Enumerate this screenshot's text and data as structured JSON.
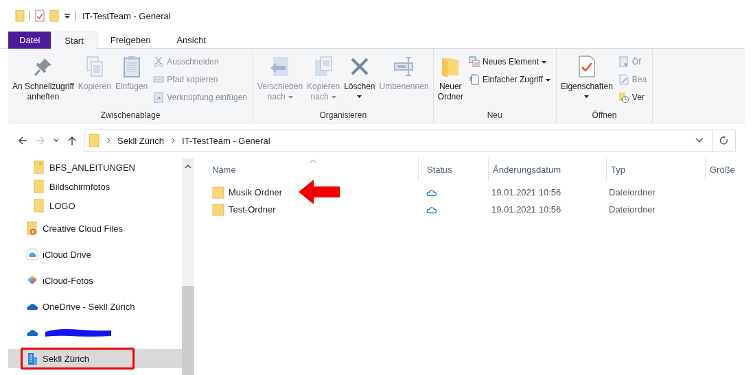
{
  "title_bar": {
    "title": "IT-TestTeam - General"
  },
  "ribbon_tabs": [
    {
      "label": "Datei",
      "kind": "file",
      "selected": false
    },
    {
      "label": "Start",
      "kind": "tab",
      "selected": true
    },
    {
      "label": "Freigeben",
      "kind": "tab",
      "selected": false
    },
    {
      "label": "Ansicht",
      "kind": "tab",
      "selected": false
    }
  ],
  "ribbon_groups": [
    {
      "label": "Zwischenablage",
      "items": [
        {
          "kind": "large",
          "lines": [
            "An Schnellzugriff",
            "anheften"
          ],
          "disabled": false,
          "dropdown": false
        },
        {
          "kind": "large",
          "lines": [
            "Kopieren"
          ],
          "disabled": true,
          "dropdown": false
        },
        {
          "kind": "large",
          "lines": [
            "Einfügen"
          ],
          "disabled": true,
          "dropdown": false
        },
        {
          "kind": "small",
          "lines": [
            "Ausschneiden"
          ],
          "disabled": true,
          "dropdown": false
        },
        {
          "kind": "small",
          "lines": [
            "Pfad kopieren"
          ],
          "disabled": true,
          "dropdown": false
        },
        {
          "kind": "small",
          "lines": [
            "Verknüpfung einfügen"
          ],
          "disabled": true,
          "dropdown": false
        }
      ]
    },
    {
      "label": "Organisieren",
      "items": [
        {
          "kind": "large",
          "lines": [
            "Verschieben",
            "nach"
          ],
          "disabled": true,
          "dropdown": true
        },
        {
          "kind": "large",
          "lines": [
            "Kopieren",
            "nach"
          ],
          "disabled": true,
          "dropdown": true
        },
        {
          "kind": "large",
          "lines": [
            "Löschen"
          ],
          "disabled": false,
          "dropdown": true
        },
        {
          "kind": "large",
          "lines": [
            "Umbenennen"
          ],
          "disabled": true,
          "dropdown": false
        }
      ]
    },
    {
      "label": "Neu",
      "items": [
        {
          "kind": "large",
          "lines": [
            "Neuer",
            "Ordner"
          ],
          "disabled": false,
          "dropdown": false
        },
        {
          "kind": "small",
          "lines": [
            "Neues Element"
          ],
          "disabled": false,
          "dropdown": true
        },
        {
          "kind": "small",
          "lines": [
            "Einfacher Zugriff"
          ],
          "disabled": false,
          "dropdown": true
        }
      ]
    },
    {
      "label": "Öffnen",
      "items": [
        {
          "kind": "large",
          "lines": [
            "Eigenschaften"
          ],
          "disabled": false,
          "dropdown": true
        },
        {
          "kind": "small",
          "lines": [
            "Öf"
          ],
          "disabled": true,
          "dropdown": false
        },
        {
          "kind": "small",
          "lines": [
            "Bea"
          ],
          "disabled": true,
          "dropdown": false
        },
        {
          "kind": "small",
          "lines": [
            "Ver"
          ],
          "disabled": false,
          "dropdown": false
        }
      ]
    }
  ],
  "navigation": {
    "back_disabled": false,
    "forward_disabled": true,
    "up_disabled": false
  },
  "address_bar": {
    "crumbs": [
      "Sekll Zürich",
      "IT-TestTeam - General"
    ]
  },
  "sidebar": {
    "items": [
      {
        "children": [
          {
            "label": "BFS_ANLEITUNGEN",
            "kind": "folder-doc",
            "selected": false,
            "highlighted": false
          },
          {
            "label": "Bildschirmfotos",
            "kind": "folder",
            "selected": false,
            "highlighted": false
          },
          {
            "label": "LOGO",
            "kind": "folder",
            "selected": false,
            "highlighted": false
          }
        ]
      },
      {
        "label": "Creative Cloud Files",
        "kind": "cc-folder",
        "selected": false,
        "highlighted": false
      },
      {
        "label": "iCloud Drive",
        "kind": "icloud",
        "selected": false,
        "highlighted": false
      },
      {
        "label": "iCloud-Fotos",
        "kind": "photos",
        "selected": false,
        "highlighted": false
      },
      {
        "label": "OneDrive - Sekll Zürich",
        "kind": "onedrive",
        "selected": false,
        "highlighted": false
      },
      {
        "kind": "onedrive",
        "redacted": true,
        "selected": false,
        "highlighted": false
      },
      {
        "label": "Sekll Zürich",
        "kind": "building",
        "selected": true,
        "highlighted": true
      }
    ]
  },
  "file_list": {
    "columns": [
      {
        "label": "Name",
        "sorted": true
      },
      {
        "label": "Status",
        "sorted": false
      },
      {
        "label": "Änderungsdatum",
        "sorted": false
      },
      {
        "label": "Typ",
        "sorted": false
      },
      {
        "label": "Größe",
        "sorted": false
      }
    ],
    "rows": [
      {
        "name": "Musik Ordner",
        "cloud": true,
        "modified": "19.01.2021 10:56",
        "type": "Dateiordner",
        "marked": true
      },
      {
        "name": "Test-Ordner",
        "cloud": true,
        "modified": "19.01.2021 10:56",
        "type": "Dateiordner",
        "marked": false
      }
    ]
  }
}
